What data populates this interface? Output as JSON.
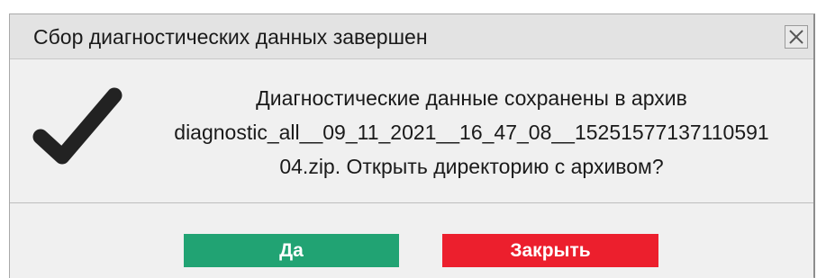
{
  "window": {
    "title": "Сбор диагностических данных завершен",
    "close_icon": "close-x-icon"
  },
  "message": {
    "status_icon": "checkmark-icon",
    "lines": [
      "Диагностические данные сохранены в архив",
      "diagnostic_all__09_11_2021__16_47_08__15251577137110591",
      "04.zip. Открыть директорию с архивом?"
    ]
  },
  "buttons": {
    "yes_label": "Да",
    "close_label": "Закрыть"
  },
  "colors": {
    "yes_button": "#21a373",
    "close_button": "#ec1f2d",
    "checkmark": "#222222"
  }
}
